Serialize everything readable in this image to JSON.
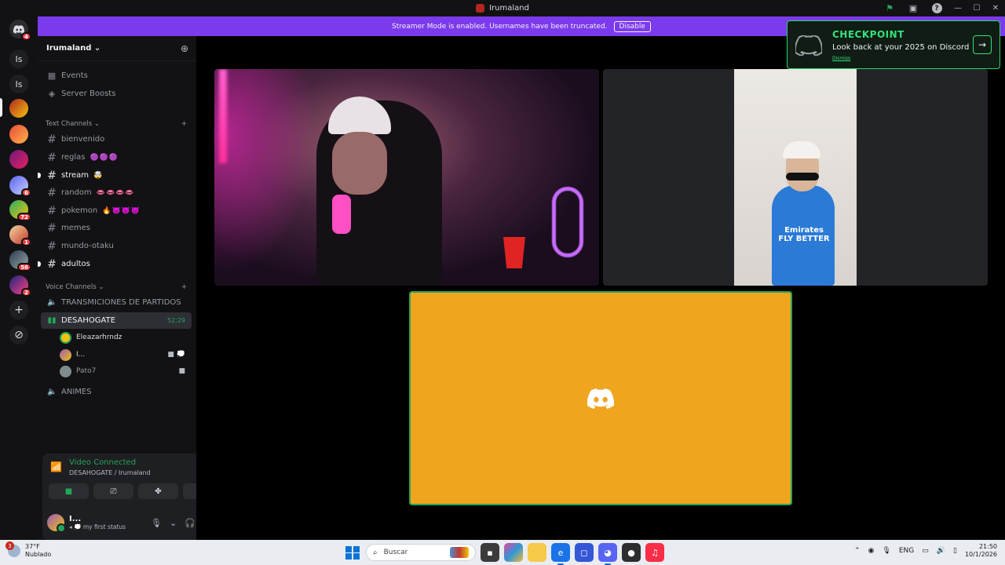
{
  "window": {
    "title": "Irumaland"
  },
  "notice": {
    "text": "Streamer Mode is enabled. Usernames have been truncated.",
    "button": "Disable"
  },
  "rail": {
    "home_badge": "4",
    "text_items": [
      "Is",
      "Is"
    ],
    "badges": [
      "6",
      "72",
      "1",
      "56",
      "2"
    ]
  },
  "server": {
    "name": "Irumaland"
  },
  "nav": {
    "events": "Events",
    "boosts": "Server Boosts"
  },
  "text_category": "Text Channels",
  "text_channels": [
    {
      "name": "bienvenido",
      "emoji": ""
    },
    {
      "name": "reglas",
      "emoji": "🟣🟣🟣"
    },
    {
      "name": "stream",
      "emoji": "🤯"
    },
    {
      "name": "random",
      "emoji": "👄👄👄👄"
    },
    {
      "name": "pokemon",
      "emoji": "🔥👿👿👿"
    },
    {
      "name": "memes",
      "emoji": ""
    },
    {
      "name": "mundo-otaku",
      "emoji": ""
    },
    {
      "name": "adultos",
      "emoji": ""
    }
  ],
  "voice_category": "Voice Channels",
  "voice_channels": {
    "partidos": "TRANSMICIONES DE PARTIDOS",
    "desahogate": "DESAHOGATE",
    "timer": "52:29",
    "animes": "ANIMES"
  },
  "voice_users": [
    {
      "name": "Eleazarhrndz"
    },
    {
      "name": "I..."
    },
    {
      "name": "Pato7"
    }
  ],
  "voice_panel": {
    "status": "Video Connected",
    "location": "DESAHOGATE / Irumaland"
  },
  "user": {
    "name": "I...",
    "status": "my first status"
  },
  "checkpoint": {
    "title": "CHECKPOINT",
    "subtitle": "Look back at your 2025 on Discord",
    "dismiss": "Dismiss"
  },
  "stream": {
    "jersey_text": "Emirates FLY BETTER"
  },
  "taskbar": {
    "weather_temp": "37°F",
    "weather_desc": "Nublado",
    "weather_badge": "3",
    "search_placeholder": "Buscar",
    "lang": "ENG",
    "time": "21:50",
    "date": "10/1/2026"
  },
  "colors": {
    "accent": "#7c3aed",
    "connected": "#23a55a",
    "tile_bg": "#f0a51f",
    "checkpoint": "#35e07b"
  }
}
